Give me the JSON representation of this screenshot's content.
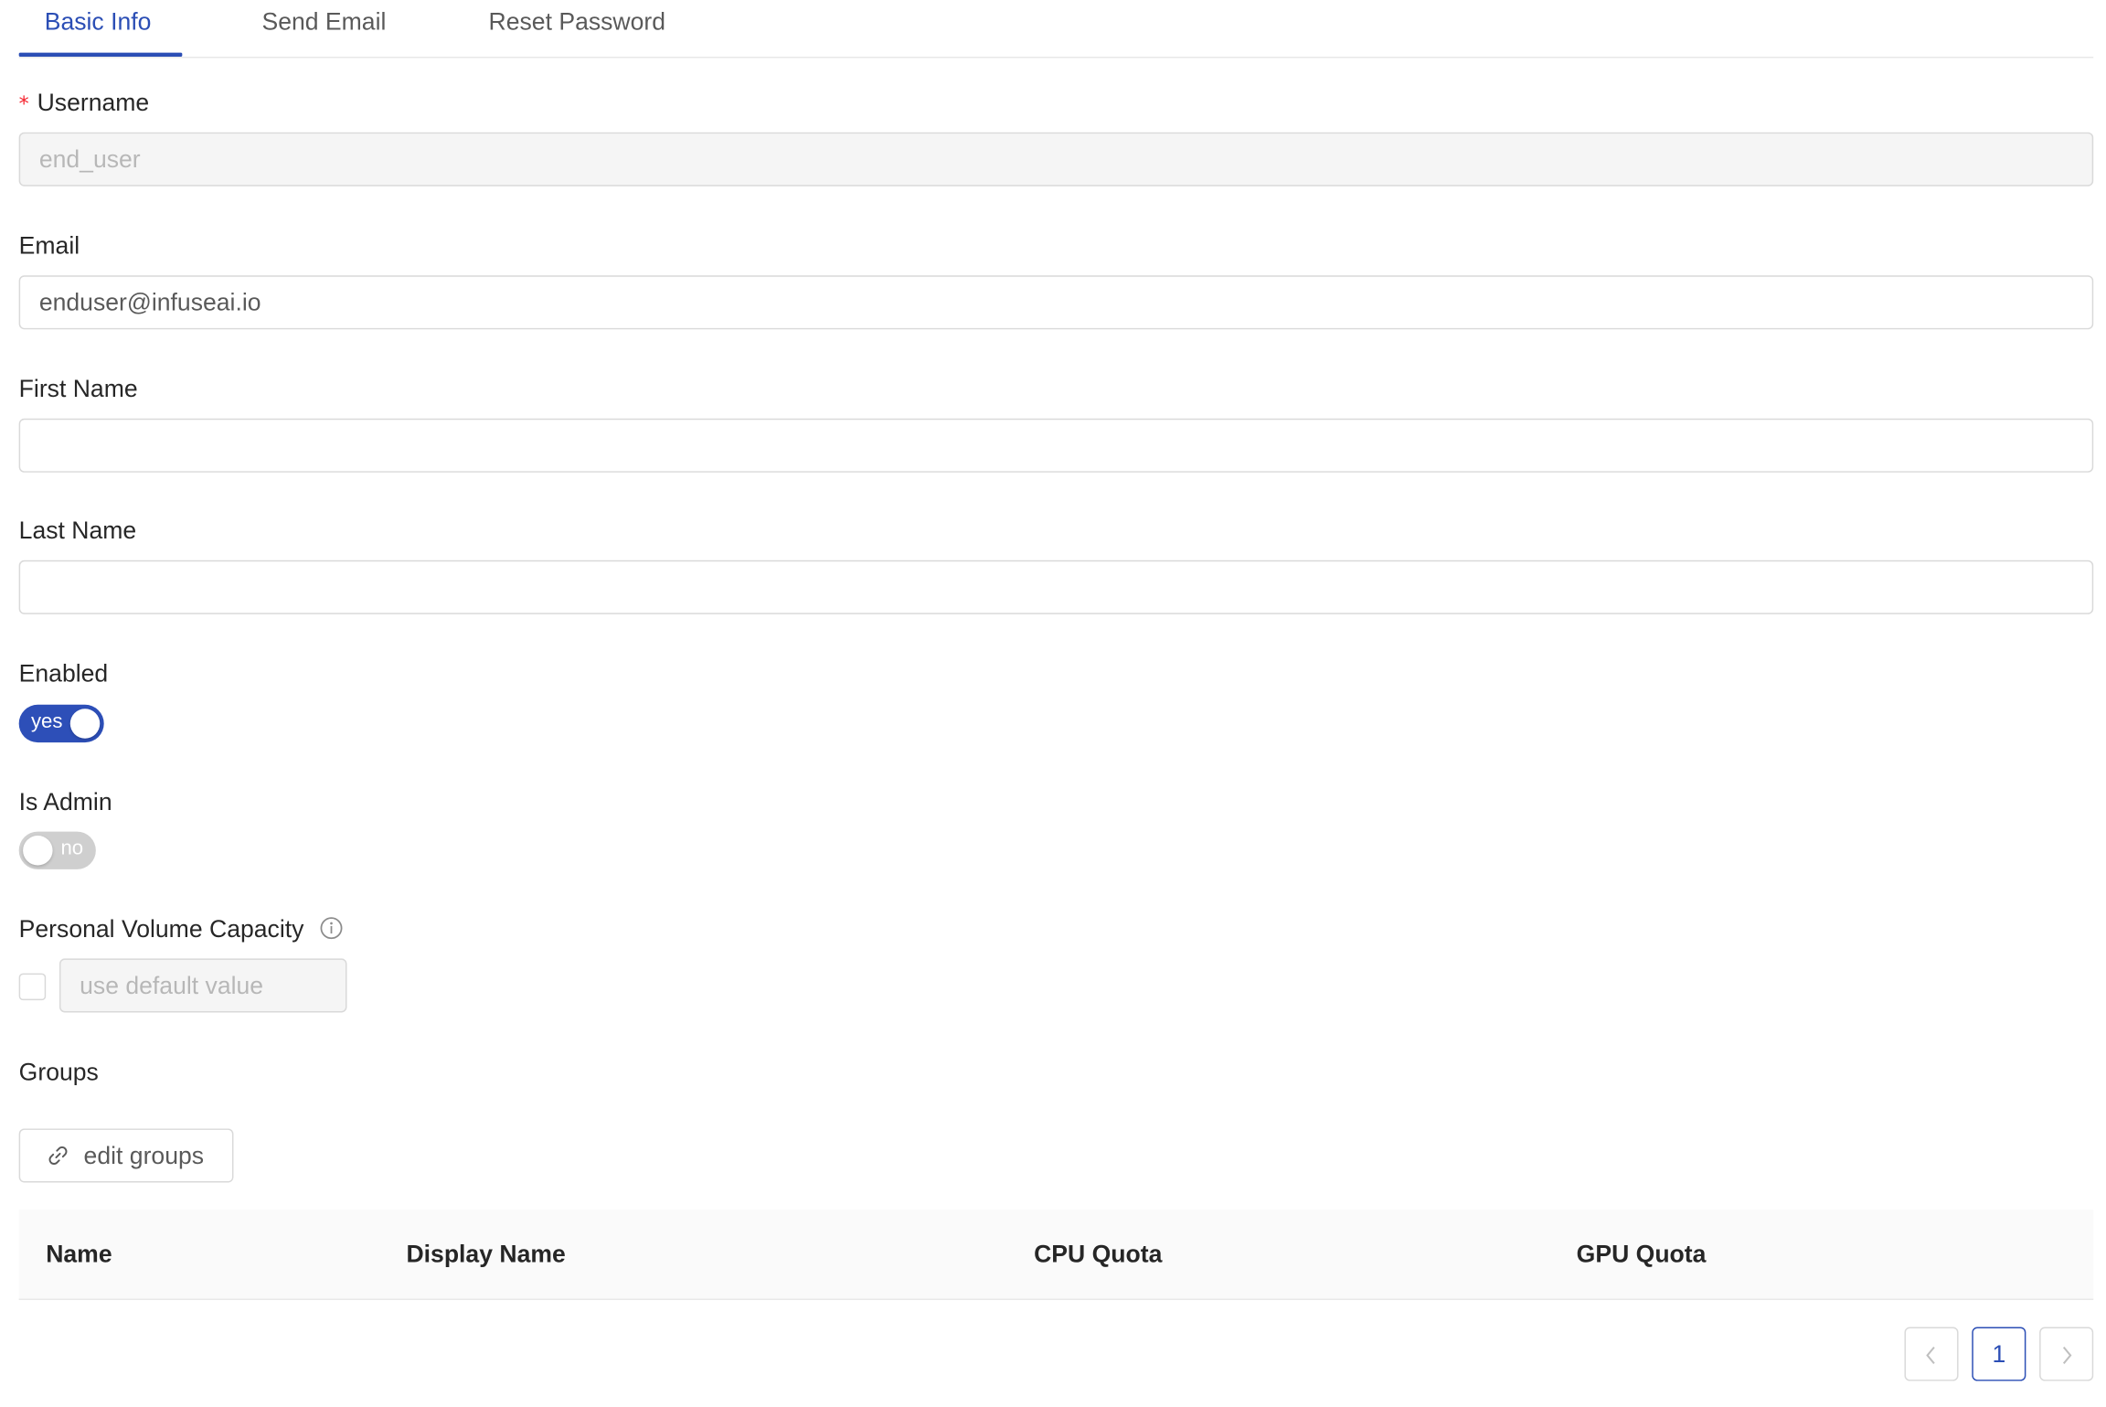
{
  "tabs": [
    {
      "label": "Basic Info",
      "active": true
    },
    {
      "label": "Send Email",
      "active": false
    },
    {
      "label": "Reset Password",
      "active": false
    }
  ],
  "form": {
    "username": {
      "required_mark": "*",
      "label": "Username",
      "value": "end_user",
      "disabled": true
    },
    "email": {
      "label": "Email",
      "value": "enduser@infuseai.io"
    },
    "first_name": {
      "label": "First Name",
      "value": ""
    },
    "last_name": {
      "label": "Last Name",
      "value": ""
    },
    "enabled": {
      "label": "Enabled",
      "state_text": "yes",
      "checked": true
    },
    "is_admin": {
      "label": "Is Admin",
      "state_text": "no",
      "checked": false
    },
    "personal_volume": {
      "label": "Personal Volume Capacity",
      "info_icon": "info-circle-icon",
      "use_default_checked": false,
      "placeholder": "use default value"
    },
    "groups": {
      "label": "Groups",
      "edit_button_label": "edit groups",
      "edit_button_icon": "link-icon"
    }
  },
  "table": {
    "columns": [
      "Name",
      "Display Name",
      "CPU Quota",
      "GPU Quota"
    ],
    "rows": []
  },
  "pagination": {
    "current_page": "1",
    "prev_icon": "chevron-left-icon",
    "next_icon": "chevron-right-icon"
  },
  "colors": {
    "accent": "#2b4eb5",
    "required": "#f5222d",
    "switch_off": "#cfcfcf"
  }
}
